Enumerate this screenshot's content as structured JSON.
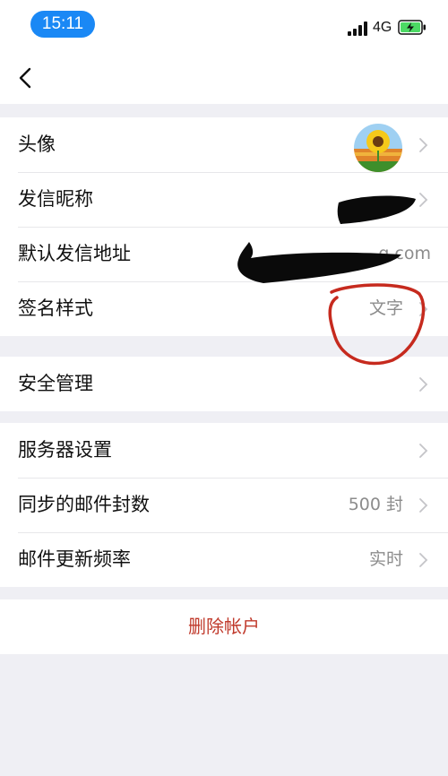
{
  "status_bar": {
    "time": "15:11",
    "network": "4G",
    "icons": [
      "signal-icon",
      "battery-charging-icon"
    ],
    "accent_color": "#1a88f5"
  },
  "nav": {
    "back_icon": "chevron-left-icon"
  },
  "account_group": {
    "rows": [
      {
        "label": "头像",
        "value": "",
        "icon": "sunflower-avatar"
      },
      {
        "label": "发信昵称",
        "value": ""
      },
      {
        "label": "默认发信地址",
        "value": "q.com"
      },
      {
        "label": "签名样式",
        "value": "文字"
      }
    ]
  },
  "security_group": {
    "rows": [
      {
        "label": "安全管理",
        "value": ""
      }
    ]
  },
  "server_group": {
    "rows": [
      {
        "label": "服务器设置",
        "value": ""
      },
      {
        "label": "同步的邮件封数",
        "value": "500 封"
      },
      {
        "label": "邮件更新频率",
        "value": "实时"
      }
    ]
  },
  "delete": {
    "label": "删除帐户",
    "color": "#c0392b"
  },
  "annotation": {
    "color": "#c0392b"
  }
}
